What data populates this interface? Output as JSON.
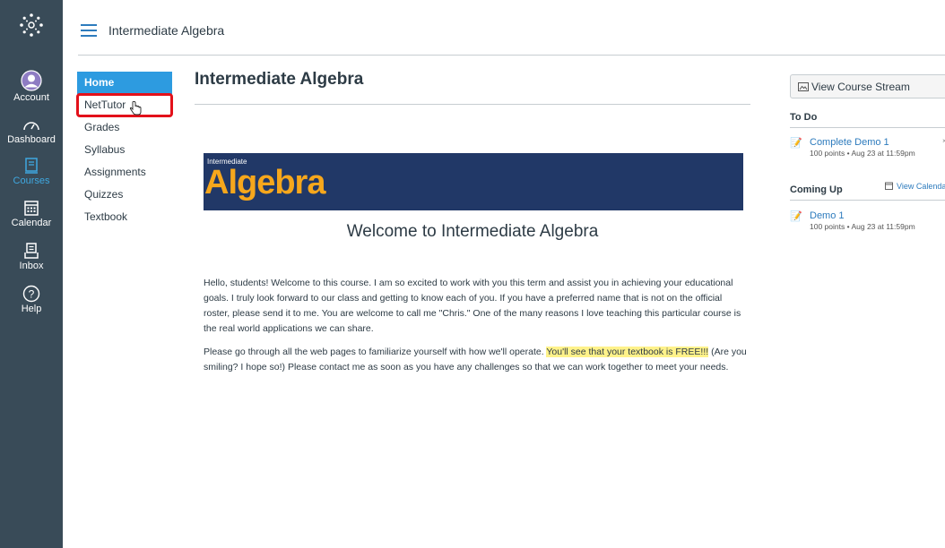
{
  "global_nav": {
    "items": [
      {
        "label": "Account",
        "icon": "account-avatar-icon"
      },
      {
        "label": "Dashboard",
        "icon": "dashboard-gauge-icon"
      },
      {
        "label": "Courses",
        "icon": "courses-book-icon"
      },
      {
        "label": "Calendar",
        "icon": "calendar-icon"
      },
      {
        "label": "Inbox",
        "icon": "inbox-icon"
      },
      {
        "label": "Help",
        "icon": "help-question-icon"
      }
    ],
    "active": "Courses",
    "colors": {
      "background": "#394b58",
      "active": "#3fa8e0"
    }
  },
  "breadcrumb": {
    "course": "Intermediate Algebra"
  },
  "course_nav": {
    "items": [
      "Home",
      "NetTutor",
      "Grades",
      "Syllabus",
      "Assignments",
      "Quizzes",
      "Textbook"
    ],
    "active": "Home",
    "highlighted": "NetTutor"
  },
  "main": {
    "title": "Intermediate Algebra",
    "banner": {
      "small_text": "Intermediate",
      "big_text": "Algebra"
    },
    "welcome": "Welcome to Intermediate Algebra",
    "para1": "Hello, students! Welcome to this course. I am so excited to work with you this term and assist you in achieving your educational goals. I truly look forward to our class and getting to know each of you. If you have a preferred name that is not on the official roster, please send it to me. You are welcome to call me \"Chris.\" One of the many reasons I love teaching this particular course is the real world applications we can share.",
    "para2_pre": "Please go through all the web pages to familiarize yourself with how we'll operate. ",
    "para2_highlight": "You'll see that your textbook is FREE!!!",
    "para2_post": " (Are you smiling? I hope so!) Please contact me as soon as you have any challenges so that we can work together to meet your needs."
  },
  "sidebar": {
    "stream_button": "View Course Stream",
    "todo_heading": "To Do",
    "todo_items": [
      {
        "title": "Complete Demo 1",
        "meta": "100 points • Aug 23 at 11:59pm"
      }
    ],
    "coming_heading": "Coming Up",
    "view_calendar": "View Calenda",
    "coming_items": [
      {
        "title": "Demo 1",
        "meta": "100 points • Aug 23 at 11:59pm"
      }
    ]
  }
}
